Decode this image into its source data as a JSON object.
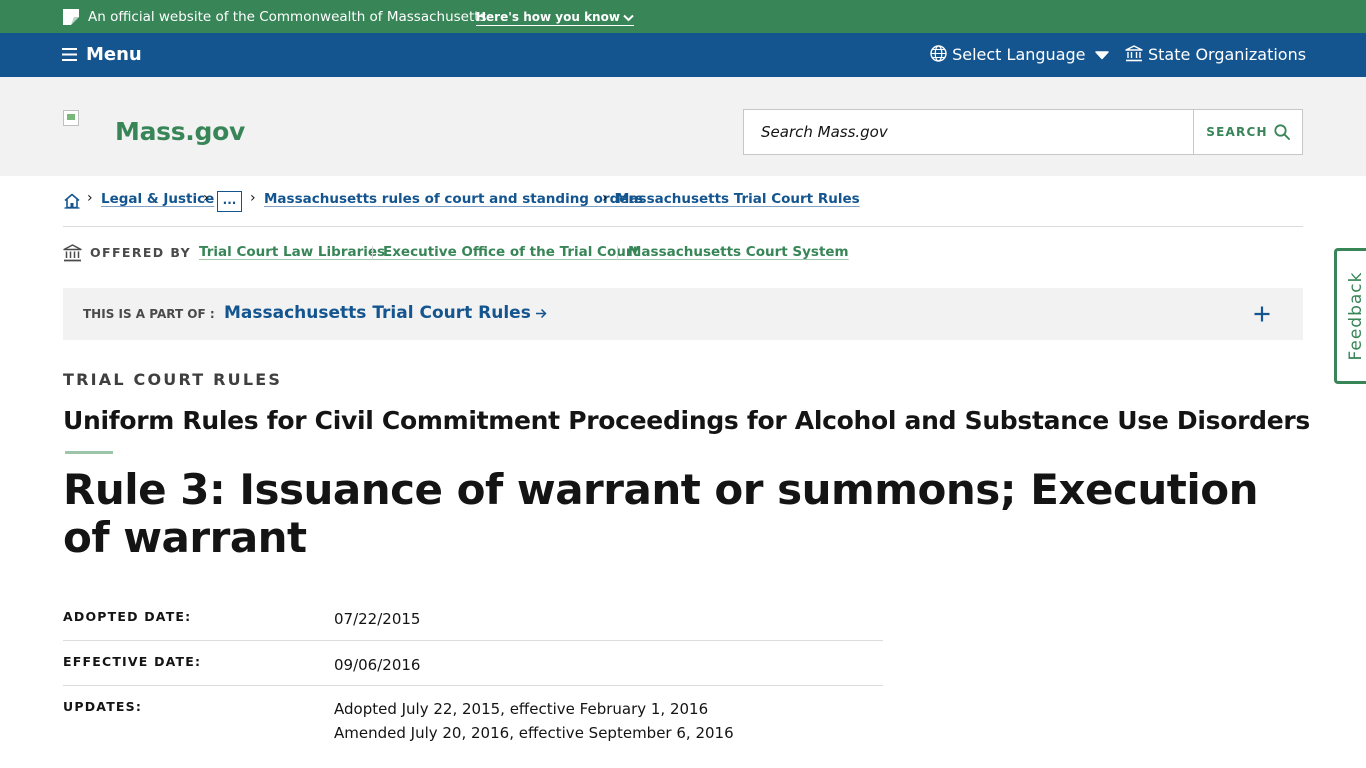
{
  "topbar": {
    "official_text": "An official website of the Commonwealth of Massachusetts",
    "how_you_know": "Here's how you know"
  },
  "navbar": {
    "menu_label": "Menu",
    "language_label": "Select Language",
    "state_orgs_label": "State Organizations"
  },
  "header": {
    "logo_text": "Mass.gov",
    "search_placeholder": "Search Mass.gov",
    "search_button": "SEARCH"
  },
  "breadcrumb": {
    "items": [
      "Legal & Justice",
      "...",
      "Massachusetts rules of court and standing orders",
      "Massachusetts Trial Court Rules"
    ]
  },
  "offered_by": {
    "label": "OFFERED BY",
    "orgs": [
      "Trial Court Law Libraries",
      "Executive Office of the Trial Court",
      "Massachusetts Court System"
    ]
  },
  "part_of": {
    "label": "THIS IS A PART OF :",
    "link": "Massachusetts Trial Court Rules"
  },
  "feedback_label": "Feedback",
  "page": {
    "category": "TRIAL COURT RULES",
    "subtitle": "Uniform Rules for Civil Commitment Proceedings for Alcohol and Substance Use Disorders",
    "title": "Rule 3: Issuance of warrant or summons; Execution of warrant"
  },
  "metadata": {
    "adopted_label": "ADOPTED DATE:",
    "adopted_value": "07/22/2015",
    "effective_label": "EFFECTIVE DATE:",
    "effective_value": "09/06/2016",
    "updates_label": "UPDATES:",
    "updates": [
      "Adopted July 22, 2015, effective February 1, 2016",
      "Amended July 20, 2016, effective September 6, 2016"
    ]
  },
  "colors": {
    "top_green": "#388557",
    "nav_blue": "#14558f",
    "header_gray": "#f2f2f2",
    "link_blue": "#14558f",
    "link_green": "#388557"
  }
}
